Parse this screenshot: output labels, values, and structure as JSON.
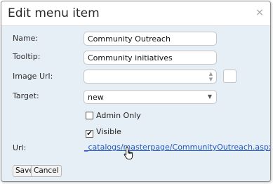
{
  "dialog": {
    "title": "Edit menu item",
    "close_glyph": "×"
  },
  "form": {
    "name_label": "Name:",
    "name_value": "Community Outreach",
    "tooltip_label": "Tooltip:",
    "tooltip_value": "Community initiatives",
    "image_url_label": "Image Url:",
    "image_url_value": "",
    "target_label": "Target:",
    "target_value": "new",
    "admin_only_label": "Admin Only",
    "admin_only_checked": false,
    "visible_label": "Visible",
    "visible_checked": true,
    "url_label": "Url:",
    "url_value": "_catalogs/masterpage/CommunityOutreach.aspx"
  },
  "buttons": {
    "save": "Save",
    "cancel": "Cancel"
  },
  "icons": {
    "close": "close-icon",
    "spinner": "spinner-arrows-icon",
    "caret": "chevron-down-icon",
    "cursor": "hand-pointer-icon"
  },
  "colors": {
    "panel_bg": "#e6eef6",
    "link": "#1f57c7"
  }
}
